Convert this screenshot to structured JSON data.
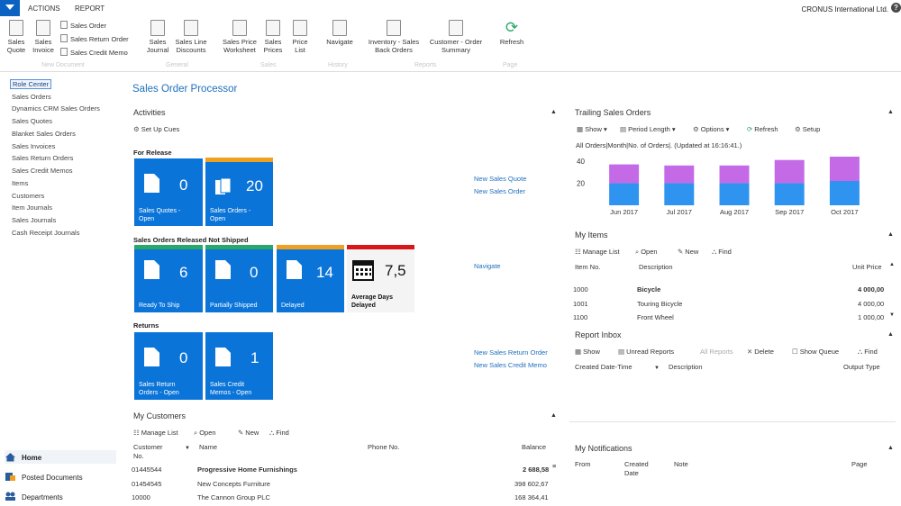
{
  "topbar": {
    "tabs": [
      "ACTIONS",
      "REPORT"
    ],
    "company": "CRONUS International Ltd.",
    "help": "?"
  },
  "ribbon": {
    "sales_quote": "Sales\nQuote",
    "sales_invoice": "Sales\nInvoice",
    "small_sales_order": "Sales Order",
    "small_sales_return": "Sales Return Order",
    "small_sales_credit": "Sales Credit Memo",
    "sales_journal": "Sales\nJournal",
    "sales_line_discounts": "Sales Line\nDiscounts",
    "sales_price_worksheet": "Sales Price\nWorksheet",
    "sales_prices": "Sales\nPrices",
    "price_list": "Price\nList",
    "navigate": "Navigate",
    "inventory_sales_back_orders": "Inventory - Sales\nBack Orders",
    "customer_order_summary": "Customer - Order\nSummary",
    "refresh": "Refresh",
    "groups": [
      "New Document",
      "General",
      "Sales",
      "History",
      "Reports",
      "Page"
    ]
  },
  "nav": {
    "items": [
      "Role Center",
      "Sales Orders",
      "Dynamics CRM Sales Orders",
      "Sales Quotes",
      "Blanket Sales Orders",
      "Sales Invoices",
      "Sales Return Orders",
      "Sales Credit Memos",
      "Items",
      "Customers",
      "Item Journals",
      "Sales Journals",
      "Cash Receipt Journals"
    ],
    "bottom": [
      "Home",
      "Posted Documents",
      "Departments"
    ]
  },
  "page": {
    "title": "Sales Order Processor"
  },
  "activities": {
    "title": "Activities",
    "setup_cues": "Set Up Cues",
    "for_release": "For Release",
    "released_not_shipped": "Sales Orders Released Not Shipped",
    "returns": "Returns",
    "tiles": {
      "quotes_open": {
        "value": "0",
        "label": "Sales Quotes -\nOpen"
      },
      "orders_open": {
        "value": "20",
        "label": "Sales Orders -\nOpen"
      },
      "ready_to_ship": {
        "value": "6",
        "label": "Ready To Ship"
      },
      "partially_shipped": {
        "value": "0",
        "label": "Partially Shipped"
      },
      "delayed": {
        "value": "14",
        "label": "Delayed"
      },
      "avg_days_delayed": {
        "value": "7,5",
        "label": "Average Days\nDelayed"
      },
      "return_orders_open": {
        "value": "0",
        "label": "Sales Return\nOrders - Open"
      },
      "credit_memos_open": {
        "value": "1",
        "label": "Sales Credit\nMemos - Open"
      }
    },
    "links": {
      "new_quote": "New Sales Quote",
      "new_order": "New Sales Order",
      "navigate": "Navigate",
      "new_return": "New Sales Return Order",
      "new_credit": "New Sales Credit Memo"
    },
    "stripe_colors": {
      "orders": "#f0a020",
      "ready": "#2aa86a",
      "partial": "#2aa86a",
      "delayed": "#f0a020",
      "avg": "#d81818"
    }
  },
  "customers": {
    "title": "My Customers",
    "toolbar": [
      "Manage List",
      "Open",
      "New",
      "Find"
    ],
    "headers": {
      "no": "Customer\nNo.",
      "name": "Name",
      "phone": "Phone No.",
      "balance": "Balance"
    },
    "rows": [
      {
        "no": "01445544",
        "name": "Progressive Home Furnishings",
        "balance": "2 688,58"
      },
      {
        "no": "01454545",
        "name": "New Concepts Furniture",
        "balance": "398 602,67"
      },
      {
        "no": "10000",
        "name": "The Cannon Group PLC",
        "balance": "168 364,41"
      }
    ]
  },
  "trailing": {
    "title": "Trailing Sales Orders",
    "toolbar": [
      "Show",
      "Period Length",
      "Options",
      "Refresh",
      "Setup"
    ],
    "status": "All Orders|Month|No. of Orders|. (Updated at 16:16:41.)"
  },
  "chart_data": {
    "type": "bar",
    "title": "",
    "categories": [
      "Jun 2017",
      "Jul 2017",
      "Aug 2017",
      "Sep 2017",
      "Oct 2017"
    ],
    "series": [
      {
        "values": [
          20,
          20,
          20,
          20,
          22
        ],
        "color": "#2e94f0"
      },
      {
        "values": [
          17,
          16,
          16,
          21,
          22
        ],
        "color": "#c46ae6"
      }
    ],
    "yticks": [
      20,
      40
    ],
    "ylim": [
      0,
      44
    ],
    "stacked": true
  },
  "items": {
    "title": "My Items",
    "toolbar": [
      "Manage List",
      "Open",
      "New",
      "Find"
    ],
    "headers": {
      "no": "Item No.",
      "desc": "Description",
      "price": "Unit Price"
    },
    "rows": [
      {
        "no": "1000",
        "desc": "Bicycle",
        "price": "4 000,00"
      },
      {
        "no": "1001",
        "desc": "Touring Bicycle",
        "price": "4 000,00"
      },
      {
        "no": "1100",
        "desc": "Front Wheel",
        "price": "1 000,00"
      }
    ]
  },
  "report_inbox": {
    "title": "Report Inbox",
    "toolbar": [
      "Show",
      "Unread Reports",
      "All Reports",
      "Delete",
      "Show Queue",
      "Find"
    ],
    "headers": {
      "created": "Created Date-Time",
      "desc": "Description",
      "output": "Output Type"
    }
  },
  "notifications": {
    "title": "My Notifications",
    "headers": {
      "from": "From",
      "created": "Created\nDate",
      "note": "Note",
      "page": "Page"
    }
  }
}
